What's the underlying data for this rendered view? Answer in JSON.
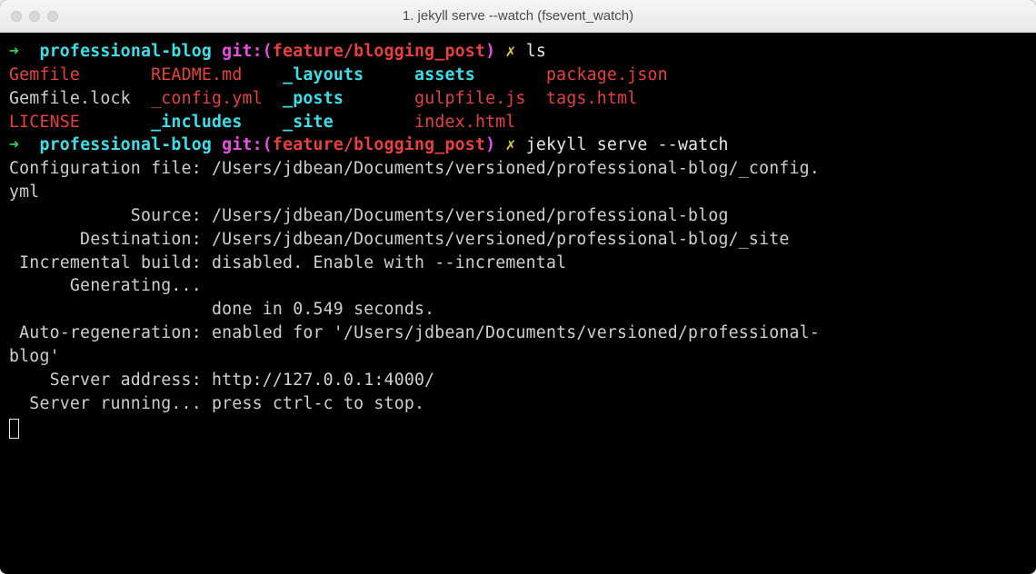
{
  "window": {
    "title": "1. jekyll serve --watch (fsevent_watch)"
  },
  "prompt": {
    "arrow": "➜",
    "path": "professional-blog",
    "git_label": "git:(",
    "branch": "feature/blogging_post",
    "git_close": ")",
    "dirty": "✗"
  },
  "cmd1": "ls",
  "ls": {
    "r1c1": "Gemfile",
    "r1c2": "README.md",
    "r1c3": "_layouts",
    "r1c4": "assets",
    "r1c5": "package.json",
    "r2c1": "Gemfile.lock",
    "r2c2": "_config.yml",
    "r2c3": "_posts",
    "r2c4": "gulpfile.js",
    "r2c5": "tags.html",
    "r3c1": "LICENSE",
    "r3c2": "_includes",
    "r3c3": "_site",
    "r3c4": "index.html"
  },
  "cmd2": "jekyll serve --watch",
  "out": {
    "l1": "Configuration file: /Users/jdbean/Documents/versioned/professional-blog/_config.",
    "l2": "yml",
    "l3": "            Source: /Users/jdbean/Documents/versioned/professional-blog",
    "l4": "       Destination: /Users/jdbean/Documents/versioned/professional-blog/_site",
    "l5": " Incremental build: disabled. Enable with --incremental",
    "l6": "      Generating...",
    "l7": "                    done in 0.549 seconds.",
    "l8": " Auto-regeneration: enabled for '/Users/jdbean/Documents/versioned/professional-",
    "l9": "blog'",
    "l10": "    Server address: http://127.0.0.1:4000/",
    "l11": "  Server running... press ctrl-c to stop."
  }
}
